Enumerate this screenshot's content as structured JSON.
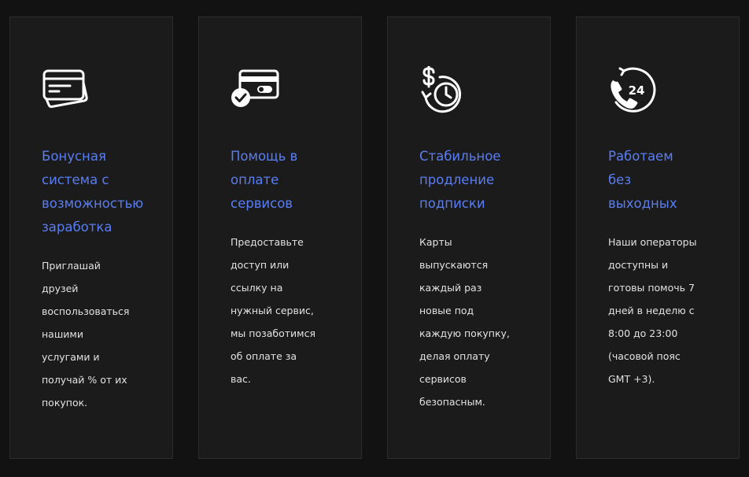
{
  "features": [
    {
      "icon": "credit-cards-icon",
      "title": "Бонусная\nсистема с\nвозможностью\nзаработка",
      "description": "Приглашай\nдрузей\nвоспользоваться\nнашими\nуслугами и\nполучай % от их\nпокупок."
    },
    {
      "icon": "card-check-icon",
      "title": "Помощь в\nоплате\nсервисов",
      "description": "Предоставьте\nдоступ или\nссылку на\nнужный сервис,\nмы позаботимся\nоб оплате за\nвас."
    },
    {
      "icon": "dollar-clock-icon",
      "title": "Стабильное\nпродление\nподписки",
      "description": "Карты\nвыпускаются\nкаждый раз\nновые под\nкаждую покупку,\nделая оплату\nсервисов\nбезопасным."
    },
    {
      "icon": "phone-24-icon",
      "title": "Работаем\nбез\nвыходных",
      "description": "Наши операторы\nдоступны и\nготовы помочь 7\nдней в неделю с\n8:00 до 23:00\n(часовой пояс\nGMT +3)."
    }
  ],
  "colors": {
    "background": "#121212",
    "card": "#1b1b1c",
    "card_border": "#2e2e30",
    "title": "#5a7df0",
    "text": "#e2e2e2"
  }
}
